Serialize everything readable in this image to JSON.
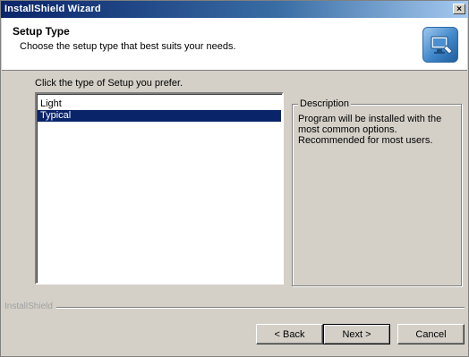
{
  "window": {
    "title": "InstallShield Wizard",
    "close_glyph": "×"
  },
  "header": {
    "title": "Setup Type",
    "subtitle": "Choose the setup type that best suits your needs.",
    "icon": "computer-setup-icon"
  },
  "prompt": "Click the type of Setup you prefer.",
  "setup_types": [
    {
      "label": "Light",
      "selected": false
    },
    {
      "label": "Typical",
      "selected": true
    }
  ],
  "description": {
    "legend": "Description",
    "text": "Program will be installed with the most common options. Recommended for most users."
  },
  "brand": "InstallShield",
  "buttons": {
    "back": "< Back",
    "next": "Next >",
    "cancel": "Cancel"
  },
  "colors": {
    "selection": "#0a246a",
    "titlebar": "#0a246a",
    "dialog": "#d4d0c8"
  }
}
